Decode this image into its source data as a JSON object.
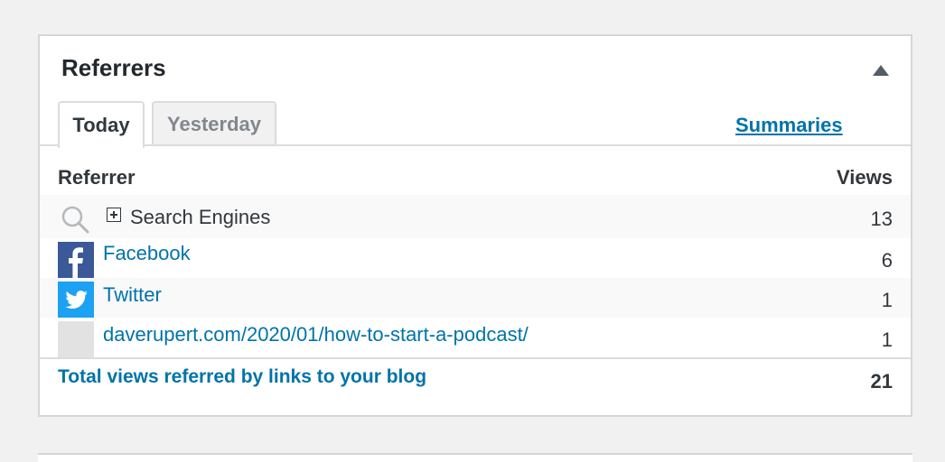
{
  "widget": {
    "title": "Referrers",
    "tabs": [
      {
        "label": "Today",
        "active": true
      },
      {
        "label": "Yesterday",
        "active": false
      }
    ],
    "summaries_link": "Summaries",
    "columns": {
      "referrer": "Referrer",
      "views": "Views"
    },
    "rows": [
      {
        "label": "Search Engines",
        "views": "13",
        "icon": "search-icon",
        "expandable": true
      },
      {
        "label": "Facebook",
        "views": "6",
        "icon": "facebook-icon"
      },
      {
        "label": "Twitter",
        "views": "1",
        "icon": "twitter-icon"
      },
      {
        "label": "daverupert.com/2020/01/how-to-start-a-podcast/",
        "views": "1",
        "icon": "blank-favicon"
      }
    ],
    "total": {
      "label": "Total views referred by links to your blog",
      "views": "21"
    }
  },
  "colors": {
    "link": "#0073aa",
    "facebook": "#3b5998",
    "twitter": "#1da1f2"
  }
}
